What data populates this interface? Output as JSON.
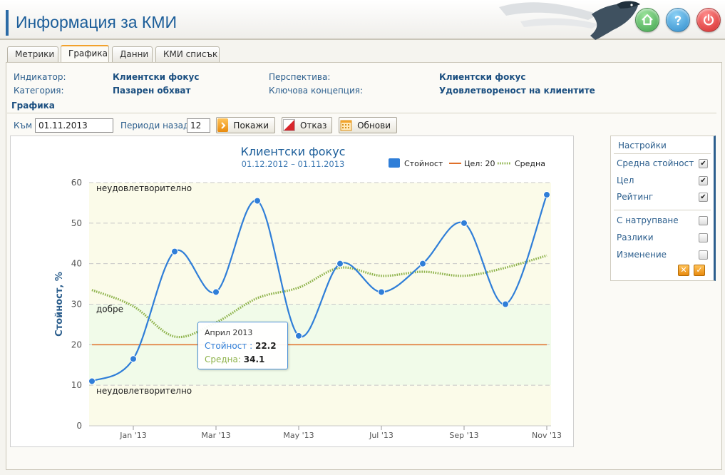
{
  "header": {
    "title": "Информация за КМИ"
  },
  "tabs": [
    {
      "label": "Метрики",
      "active": false
    },
    {
      "label": "Графика",
      "active": true
    },
    {
      "label": "Данни",
      "active": false
    },
    {
      "label": "КМИ списък",
      "active": false
    }
  ],
  "info": {
    "indicator_label": "Индикатор:",
    "indicator_value": "Клиентски фокус",
    "category_label": "Категория:",
    "category_value": "Пазарен обхват",
    "perspective_label": "Перспектива:",
    "perspective_value": "Клиентски фокус",
    "concept_label": "Ключова концепция:",
    "concept_value": "Удовлетвореност на клиентите"
  },
  "section_title": "Графика",
  "toolbar": {
    "to_label": "Към",
    "to_value": "01.11.2013",
    "periods_label": "Периоди назад",
    "periods_value": "12",
    "show_label": "Покажи",
    "cancel_label": "Отказ",
    "refresh_label": "Обнови"
  },
  "settings": {
    "title": "Настройки",
    "options": [
      {
        "label": "Средна стойност",
        "checked": true
      },
      {
        "label": "Цел",
        "checked": true
      },
      {
        "label": "Рейтинг",
        "checked": true
      },
      {
        "label": "С натрупване",
        "checked": false
      },
      {
        "label": "Разлики",
        "checked": false
      },
      {
        "label": "Изменение",
        "checked": false
      }
    ]
  },
  "tooltip": {
    "date": "Април 2013",
    "value_label": "Стойност :",
    "value": "22.2",
    "avg_label": "Средна:",
    "avg": "34.1"
  },
  "colors": {
    "value_series": "#2f7ed8",
    "target_line": "#e0702a",
    "average_series": "#8db24a",
    "band_good": "#f1fbe9",
    "band_unsat": "#fbfbe9"
  },
  "chart_data": {
    "type": "line",
    "title": "Клиентски фокус",
    "subtitle": "01.12.2012 – 01.11.2013",
    "ylabel": "Стойност, %",
    "xlabel": "",
    "ylim": [
      0,
      60
    ],
    "yticks": [
      0,
      10,
      20,
      30,
      40,
      50,
      60
    ],
    "x": [
      "2012-12",
      "2013-01",
      "2013-02",
      "2013-03",
      "2013-04",
      "2013-05",
      "2013-06",
      "2013-07",
      "2013-08",
      "2013-09",
      "2013-10",
      "2013-11"
    ],
    "xtick_labels": [
      {
        "x": "2013-01",
        "label": "Jan '13"
      },
      {
        "x": "2013-03",
        "label": "Mar '13"
      },
      {
        "x": "2013-05",
        "label": "May '13"
      },
      {
        "x": "2013-07",
        "label": "Jul '13"
      },
      {
        "x": "2013-09",
        "label": "Sep '13"
      },
      {
        "x": "2013-11",
        "label": "Nov '13"
      }
    ],
    "series": [
      {
        "name": "Стойност",
        "style": "spline-markers",
        "values": [
          11,
          16.5,
          43,
          33,
          55.5,
          22.2,
          40,
          33,
          40,
          50,
          30,
          57
        ]
      },
      {
        "name": "Цел: 20",
        "style": "line",
        "values": [
          20,
          20,
          20,
          20,
          20,
          20,
          20,
          20,
          20,
          20,
          20,
          20
        ]
      },
      {
        "name": "Средна",
        "style": "dotted",
        "values": [
          33.5,
          29.5,
          22,
          25.5,
          31.5,
          34.1,
          39,
          37,
          38,
          37,
          39,
          42
        ]
      }
    ],
    "bands": [
      {
        "from": 30,
        "to": 60,
        "label": "неудовлетворително"
      },
      {
        "from": 10,
        "to": 30,
        "label": "добре"
      },
      {
        "from": 0,
        "to": 10,
        "label": "неудовлетворително"
      }
    ],
    "legend_position": "top-right",
    "grid": true
  }
}
